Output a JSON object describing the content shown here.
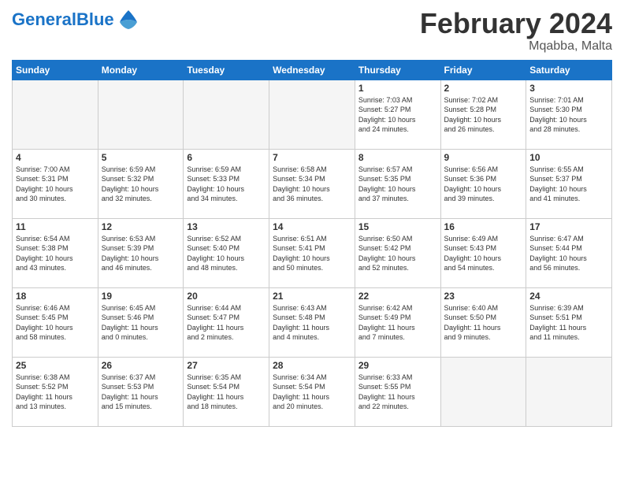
{
  "header": {
    "logo_general": "General",
    "logo_blue": "Blue",
    "month_title": "February 2024",
    "location": "Mqabba, Malta"
  },
  "weekdays": [
    "Sunday",
    "Monday",
    "Tuesday",
    "Wednesday",
    "Thursday",
    "Friday",
    "Saturday"
  ],
  "weeks": [
    [
      {
        "day": "",
        "info": ""
      },
      {
        "day": "",
        "info": ""
      },
      {
        "day": "",
        "info": ""
      },
      {
        "day": "",
        "info": ""
      },
      {
        "day": "1",
        "info": "Sunrise: 7:03 AM\nSunset: 5:27 PM\nDaylight: 10 hours\nand 24 minutes."
      },
      {
        "day": "2",
        "info": "Sunrise: 7:02 AM\nSunset: 5:28 PM\nDaylight: 10 hours\nand 26 minutes."
      },
      {
        "day": "3",
        "info": "Sunrise: 7:01 AM\nSunset: 5:30 PM\nDaylight: 10 hours\nand 28 minutes."
      }
    ],
    [
      {
        "day": "4",
        "info": "Sunrise: 7:00 AM\nSunset: 5:31 PM\nDaylight: 10 hours\nand 30 minutes."
      },
      {
        "day": "5",
        "info": "Sunrise: 6:59 AM\nSunset: 5:32 PM\nDaylight: 10 hours\nand 32 minutes."
      },
      {
        "day": "6",
        "info": "Sunrise: 6:59 AM\nSunset: 5:33 PM\nDaylight: 10 hours\nand 34 minutes."
      },
      {
        "day": "7",
        "info": "Sunrise: 6:58 AM\nSunset: 5:34 PM\nDaylight: 10 hours\nand 36 minutes."
      },
      {
        "day": "8",
        "info": "Sunrise: 6:57 AM\nSunset: 5:35 PM\nDaylight: 10 hours\nand 37 minutes."
      },
      {
        "day": "9",
        "info": "Sunrise: 6:56 AM\nSunset: 5:36 PM\nDaylight: 10 hours\nand 39 minutes."
      },
      {
        "day": "10",
        "info": "Sunrise: 6:55 AM\nSunset: 5:37 PM\nDaylight: 10 hours\nand 41 minutes."
      }
    ],
    [
      {
        "day": "11",
        "info": "Sunrise: 6:54 AM\nSunset: 5:38 PM\nDaylight: 10 hours\nand 43 minutes."
      },
      {
        "day": "12",
        "info": "Sunrise: 6:53 AM\nSunset: 5:39 PM\nDaylight: 10 hours\nand 46 minutes."
      },
      {
        "day": "13",
        "info": "Sunrise: 6:52 AM\nSunset: 5:40 PM\nDaylight: 10 hours\nand 48 minutes."
      },
      {
        "day": "14",
        "info": "Sunrise: 6:51 AM\nSunset: 5:41 PM\nDaylight: 10 hours\nand 50 minutes."
      },
      {
        "day": "15",
        "info": "Sunrise: 6:50 AM\nSunset: 5:42 PM\nDaylight: 10 hours\nand 52 minutes."
      },
      {
        "day": "16",
        "info": "Sunrise: 6:49 AM\nSunset: 5:43 PM\nDaylight: 10 hours\nand 54 minutes."
      },
      {
        "day": "17",
        "info": "Sunrise: 6:47 AM\nSunset: 5:44 PM\nDaylight: 10 hours\nand 56 minutes."
      }
    ],
    [
      {
        "day": "18",
        "info": "Sunrise: 6:46 AM\nSunset: 5:45 PM\nDaylight: 10 hours\nand 58 minutes."
      },
      {
        "day": "19",
        "info": "Sunrise: 6:45 AM\nSunset: 5:46 PM\nDaylight: 11 hours\nand 0 minutes."
      },
      {
        "day": "20",
        "info": "Sunrise: 6:44 AM\nSunset: 5:47 PM\nDaylight: 11 hours\nand 2 minutes."
      },
      {
        "day": "21",
        "info": "Sunrise: 6:43 AM\nSunset: 5:48 PM\nDaylight: 11 hours\nand 4 minutes."
      },
      {
        "day": "22",
        "info": "Sunrise: 6:42 AM\nSunset: 5:49 PM\nDaylight: 11 hours\nand 7 minutes."
      },
      {
        "day": "23",
        "info": "Sunrise: 6:40 AM\nSunset: 5:50 PM\nDaylight: 11 hours\nand 9 minutes."
      },
      {
        "day": "24",
        "info": "Sunrise: 6:39 AM\nSunset: 5:51 PM\nDaylight: 11 hours\nand 11 minutes."
      }
    ],
    [
      {
        "day": "25",
        "info": "Sunrise: 6:38 AM\nSunset: 5:52 PM\nDaylight: 11 hours\nand 13 minutes."
      },
      {
        "day": "26",
        "info": "Sunrise: 6:37 AM\nSunset: 5:53 PM\nDaylight: 11 hours\nand 15 minutes."
      },
      {
        "day": "27",
        "info": "Sunrise: 6:35 AM\nSunset: 5:54 PM\nDaylight: 11 hours\nand 18 minutes."
      },
      {
        "day": "28",
        "info": "Sunrise: 6:34 AM\nSunset: 5:54 PM\nDaylight: 11 hours\nand 20 minutes."
      },
      {
        "day": "29",
        "info": "Sunrise: 6:33 AM\nSunset: 5:55 PM\nDaylight: 11 hours\nand 22 minutes."
      },
      {
        "day": "",
        "info": ""
      },
      {
        "day": "",
        "info": ""
      }
    ]
  ]
}
